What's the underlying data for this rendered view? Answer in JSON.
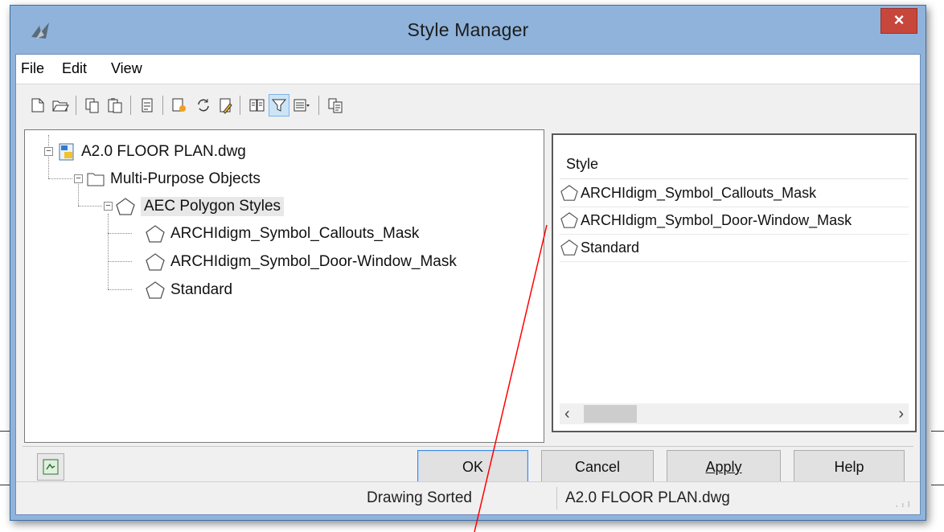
{
  "window": {
    "title": "Style Manager",
    "close_glyph": "×"
  },
  "menu": [
    "File",
    "Edit",
    "View"
  ],
  "toolbar": {
    "icons": [
      "new-icon",
      "open-icon",
      "copy-icon",
      "paste-icon",
      "purge-icon",
      "new-style-icon",
      "synchronize-icon",
      "edit-style-icon",
      "toggle-view-icon",
      "filter-style-type-icon",
      "view-options-icon",
      "inline-edit-icon"
    ]
  },
  "tree": {
    "root": "A2.0 FLOOR PLAN.dwg",
    "category": "Multi-Purpose Objects",
    "style_type": "AEC Polygon Styles",
    "styles": [
      "ARCHIdigm_Symbol_Callouts_Mask",
      "ARCHIdigm_Symbol_Door-Window_Mask",
      "Standard"
    ]
  },
  "list": {
    "column_header": "Style",
    "rows": [
      "ARCHIdigm_Symbol_Callouts_Mask",
      "ARCHIdigm_Symbol_Door-Window_Mask",
      "Standard"
    ],
    "scroll_left": "‹",
    "scroll_right": "›"
  },
  "buttons": {
    "ok": "OK",
    "cancel": "Cancel",
    "apply": "Apply",
    "help": "Help"
  },
  "status": {
    "sort": "Drawing Sorted",
    "file": "A2.0 FLOOR PLAN.dwg"
  },
  "colors": {
    "title_bar": "#8fb3db",
    "close_button": "#c7473d",
    "annotation_line": "#ff0000",
    "default_button_border": "#3c8ae3"
  }
}
